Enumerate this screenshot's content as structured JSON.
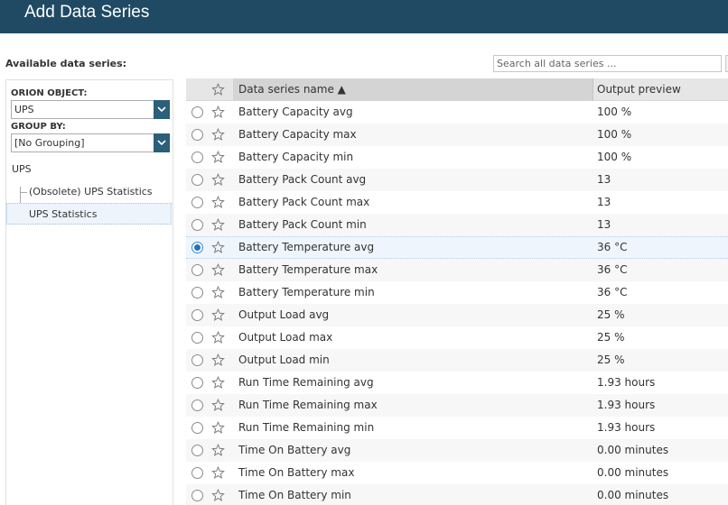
{
  "header": {
    "title": "Add Data Series"
  },
  "available_label": "Available data series:",
  "search": {
    "placeholder": "Search all data series ...",
    "value": ""
  },
  "left_panel": {
    "orion_object_label": "ORION OBJECT:",
    "orion_object_value": "UPS",
    "group_by_label": "GROUP BY:",
    "group_by_value": "[No Grouping]",
    "tree": {
      "root": "UPS",
      "children": [
        "(Obsolete) UPS Statistics",
        "UPS Statistics"
      ],
      "selected_index": 1
    }
  },
  "grid": {
    "columns": {
      "name": "Data series name ▲",
      "preview": "Output preview"
    },
    "selected_index": 6,
    "rows": [
      {
        "name": "Battery Capacity avg",
        "preview": "100 %"
      },
      {
        "name": "Battery Capacity max",
        "preview": "100 %"
      },
      {
        "name": "Battery Capacity min",
        "preview": "100 %"
      },
      {
        "name": "Battery Pack Count avg",
        "preview": "13"
      },
      {
        "name": "Battery Pack Count max",
        "preview": "13"
      },
      {
        "name": "Battery Pack Count min",
        "preview": "13"
      },
      {
        "name": "Battery Temperature avg",
        "preview": "36 °C"
      },
      {
        "name": "Battery Temperature max",
        "preview": "36 °C"
      },
      {
        "name": "Battery Temperature min",
        "preview": "36 °C"
      },
      {
        "name": "Output Load avg",
        "preview": "25 %"
      },
      {
        "name": "Output Load max",
        "preview": "25 %"
      },
      {
        "name": "Output Load min",
        "preview": "25 %"
      },
      {
        "name": "Run Time Remaining avg",
        "preview": "1.93 hours"
      },
      {
        "name": "Run Time Remaining max",
        "preview": "1.93 hours"
      },
      {
        "name": "Run Time Remaining min",
        "preview": "1.93 hours"
      },
      {
        "name": "Time On Battery avg",
        "preview": "0.00 minutes"
      },
      {
        "name": "Time On Battery max",
        "preview": "0.00 minutes"
      },
      {
        "name": "Time On Battery min",
        "preview": "0.00 minutes"
      }
    ]
  },
  "colors": {
    "header_bg": "#204a64",
    "dropdown_arrow_bg": "#2b5f7a",
    "radio_selected": "#1e74c7"
  },
  "icons": {
    "favorite": "star-outline-icon",
    "dropdown": "chevron-down-icon",
    "sort": "sort-ascending-icon"
  }
}
